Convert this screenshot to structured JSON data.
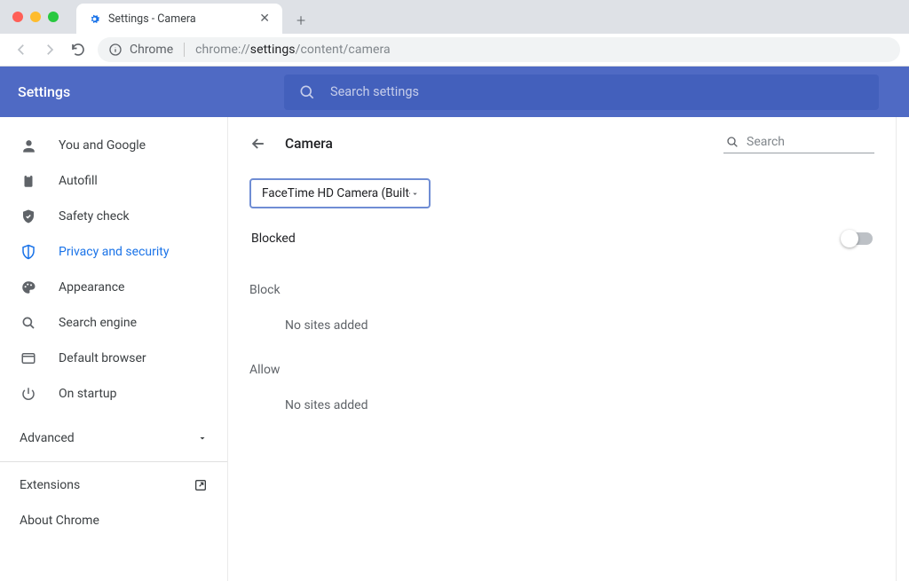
{
  "window": {
    "tab_title": "Settings - Camera"
  },
  "toolbar": {
    "scheme_label": "Chrome",
    "url_prefix": "chrome://",
    "url_bold": "settings",
    "url_suffix": "/content/camera"
  },
  "header": {
    "title": "Settings",
    "search_placeholder": "Search settings"
  },
  "sidebar": {
    "items": [
      {
        "label": "You and Google"
      },
      {
        "label": "Autofill"
      },
      {
        "label": "Safety check"
      },
      {
        "label": "Privacy and security"
      },
      {
        "label": "Appearance"
      },
      {
        "label": "Search engine"
      },
      {
        "label": "Default browser"
      },
      {
        "label": "On startup"
      }
    ],
    "advanced": "Advanced",
    "extensions": "Extensions",
    "about": "About Chrome"
  },
  "page": {
    "title": "Camera",
    "search_placeholder": "Search",
    "dropdown_value": "FaceTime HD Camera (Built-in)",
    "blocked_label": "Blocked",
    "toggle_on": false,
    "block_section": "Block",
    "allow_section": "Allow",
    "empty_text": "No sites added"
  }
}
